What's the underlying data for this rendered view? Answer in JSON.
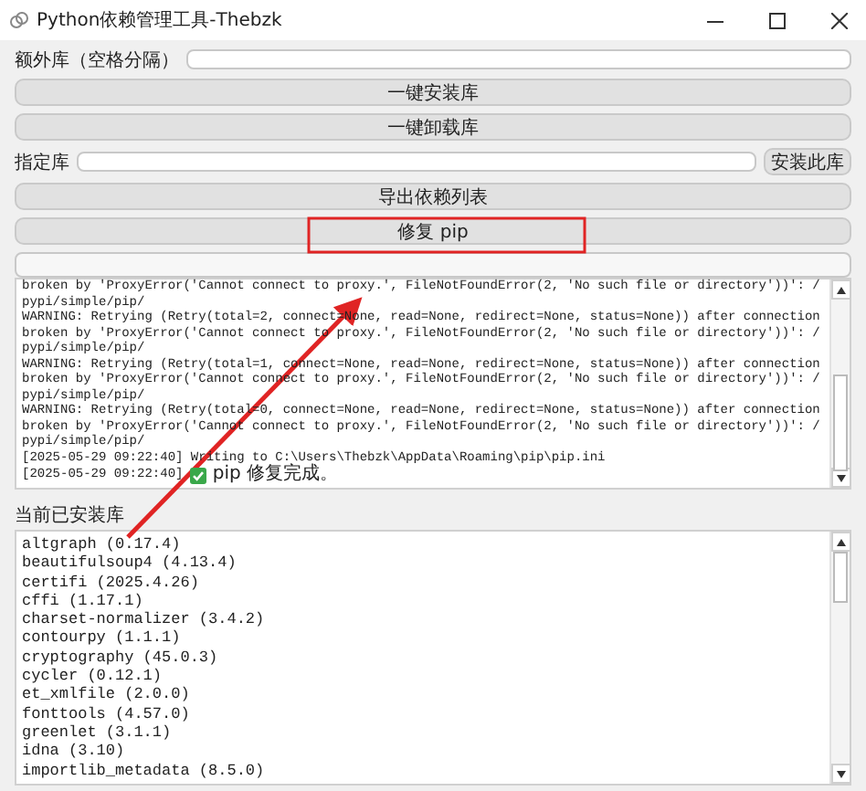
{
  "window": {
    "title": "Python依赖管理工具-Thebzk"
  },
  "extra_libraries": {
    "label": "额外库（空格分隔）"
  },
  "buttons_top": [
    "一键安装库",
    "一键卸载库"
  ],
  "specific_library": {
    "label": "指定库",
    "button": "安装此库"
  },
  "buttons_bottom": [
    "导出依赖列表",
    "修复 pip"
  ],
  "progress": {
    "level": 0
  },
  "log": [
    {
      "kind": "text",
      "text": "broken by 'ProxyError('Cannot connect to proxy.', FileNotFoundError(2, 'No such file or directory'))': /"
    },
    {
      "kind": "text",
      "text": "pypi/simple/pip/"
    },
    {
      "kind": "text",
      "text": "WARNING: Retrying (Retry(total=2, connect=None, read=None, redirect=None, status=None)) after connection"
    },
    {
      "kind": "text",
      "text": "broken by 'ProxyError('Cannot connect to proxy.', FileNotFoundError(2, 'No such file or directory'))': /"
    },
    {
      "kind": "text",
      "text": "pypi/simple/pip/"
    },
    {
      "kind": "text",
      "text": "WARNING: Retrying (Retry(total=1, connect=None, read=None, redirect=None, status=None)) after connection"
    },
    {
      "kind": "text",
      "text": "broken by 'ProxyError('Cannot connect to proxy.', FileNotFoundError(2, 'No such file or directory'))': /"
    },
    {
      "kind": "text",
      "text": "pypi/simple/pip/"
    },
    {
      "kind": "text",
      "text": "WARNING: Retrying (Retry(total=0, connect=None, read=None, redirect=None, status=None)) after connection"
    },
    {
      "kind": "text",
      "text": "broken by 'ProxyError('Cannot connect to proxy.', FileNotFoundError(2, 'No such file or directory'))': /"
    },
    {
      "kind": "text",
      "text": "pypi/simple/pip/"
    },
    {
      "kind": "text",
      "text": "[2025-05-29 09:22:40] Writing to C:\\Users\\Thebzk\\AppData\\Roaming\\pip\\pip.ini"
    },
    {
      "kind": "success",
      "time": "[2025-05-29 09:22:40]",
      "text": "pip 修复完成。"
    }
  ],
  "installed": {
    "label": "当前已安装库",
    "items": [
      "altgraph (0.17.4)",
      "beautifulsoup4 (4.13.4)",
      "certifi (2025.4.26)",
      "cffi (1.17.1)",
      "charset-normalizer (3.4.2)",
      "contourpy (1.1.1)",
      "cryptography (45.0.3)",
      "cycler (0.12.1)",
      "et_xmlfile (2.0.0)",
      "fonttools (4.57.0)",
      "greenlet (3.1.1)",
      "idna (3.10)",
      "importlib_metadata (8.5.0)"
    ]
  }
}
